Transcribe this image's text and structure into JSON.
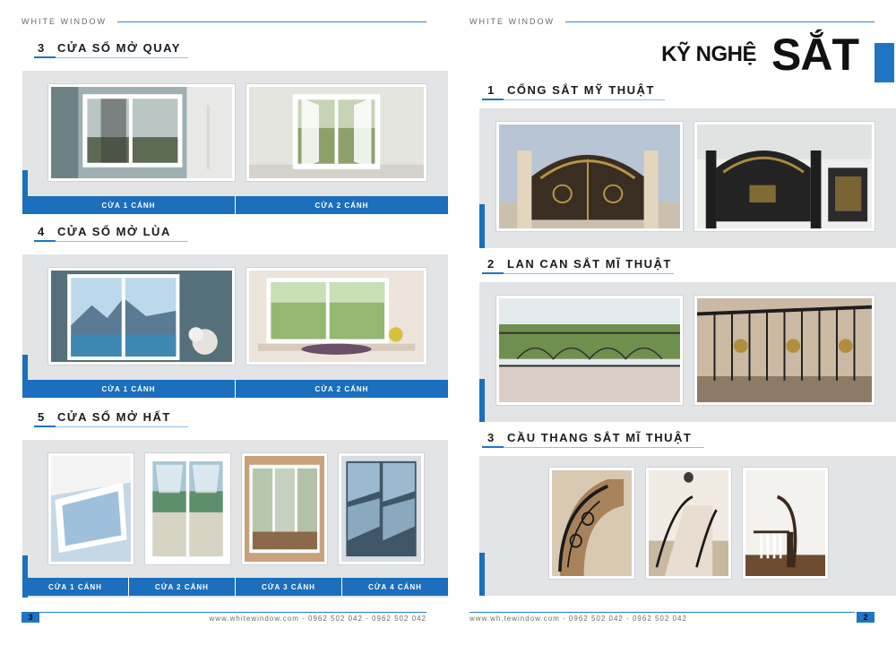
{
  "brand": "WHITE WINDOW",
  "left_page": {
    "sections": [
      {
        "number": "3",
        "title": "CỬA SỔ MỞ QUAY",
        "captions": [
          "CỬA 1 CÁNH",
          "CỬA 2 CÁNH"
        ]
      },
      {
        "number": "4",
        "title": "CỬA SỔ MỞ LÙA",
        "captions": [
          "CỬA 1 CÁNH",
          "CỬA 2 CÁNH"
        ]
      },
      {
        "number": "5",
        "title": "CỬA SỔ MỞ HẤT",
        "captions": [
          "CỬA 1 CÁNH",
          "CỬA 2 CÁNH",
          "CỬA 3 CÁNH",
          "CỬA 4 CÁNH"
        ]
      }
    ],
    "page_number": "3",
    "footer": "www.whitewindow.com - 0962 502 042 - 0962 502 042"
  },
  "right_page": {
    "heading_small": "KỸ NGHỆ",
    "heading_large": "SẮT",
    "sections": [
      {
        "number": "1",
        "title": "CỔNG SẮT MỸ THUẬT"
      },
      {
        "number": "2",
        "title": "LAN CAN SẮT MĨ THUẬT"
      },
      {
        "number": "3",
        "title": "CẦU THANG SẮT MĨ THUẬT"
      }
    ],
    "page_number": "2",
    "footer": "www.wh.tewindow.com - 0962 502 042 - 0962 502 042"
  },
  "colors": {
    "accent": "#1b6fbd",
    "panel": "#e3e4e6",
    "line": "#2a7fd0"
  }
}
